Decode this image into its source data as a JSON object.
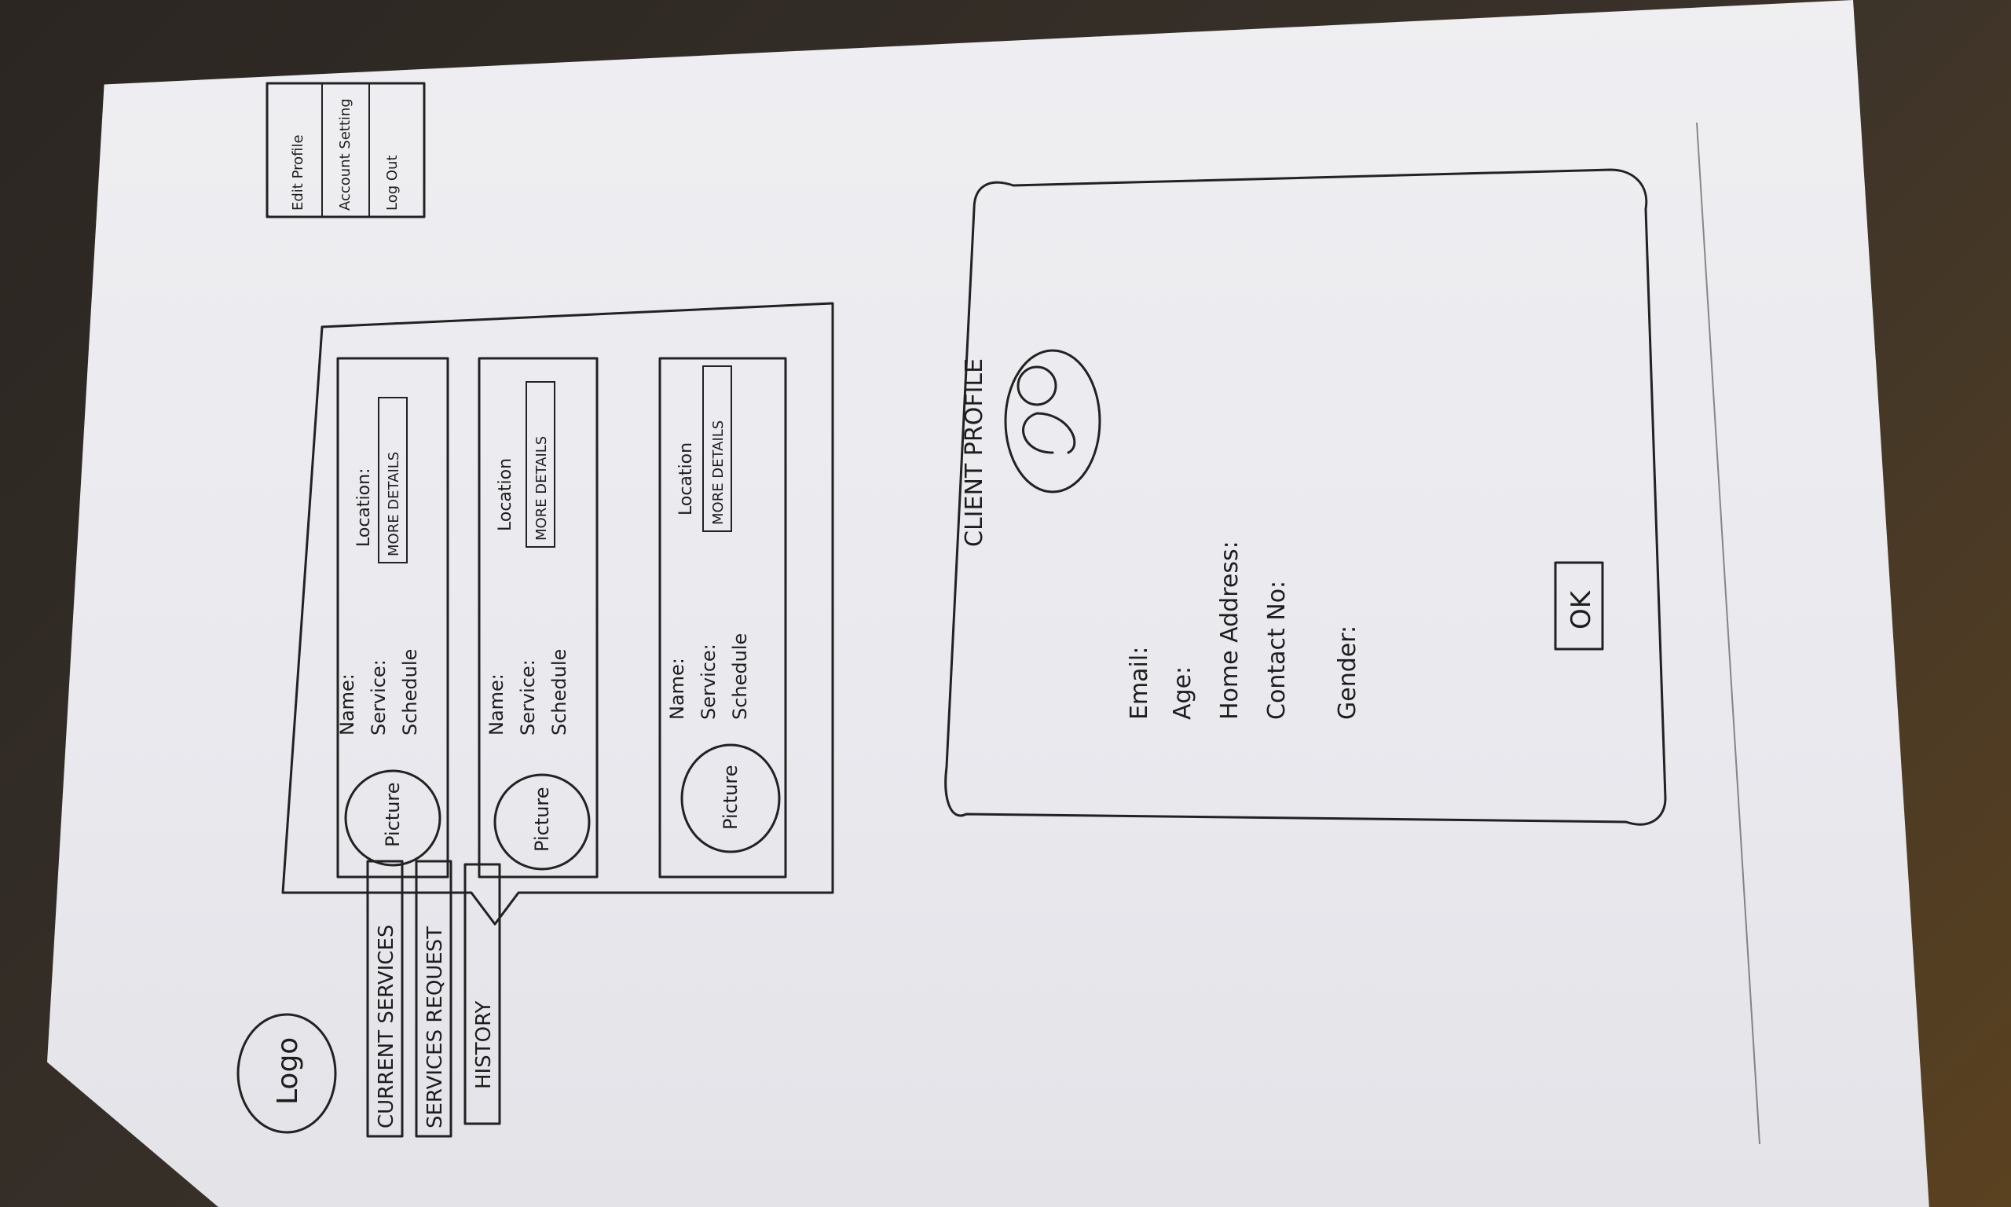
{
  "header": {
    "logo": "Logo",
    "account_menu": [
      "Edit Profile",
      "Account Setting",
      "Log Out"
    ]
  },
  "nav": {
    "tabs": [
      "CURRENT SERVICES",
      "SERVICES REQUEST",
      "HISTORY"
    ]
  },
  "requests": [
    {
      "picture": "Picture",
      "name": "Name:",
      "service": "Service:",
      "schedule": "Schedule",
      "location": "Location:",
      "button": "MORE DETAILS"
    },
    {
      "picture": "Picture",
      "name": "Name:",
      "service": "Service:",
      "schedule": "Schedule",
      "location": "Location",
      "button": "MORE DETAILS"
    },
    {
      "picture": "Picture",
      "name": "Name:",
      "service": "Service:",
      "schedule": "Schedule",
      "location": "Location",
      "button": "MORE DETAILS"
    }
  ],
  "client_profile": {
    "title": "CLIENT PROFILE",
    "fields": [
      "Email:",
      "Age:",
      "Home Address:",
      "Contact No:",
      "Gender:"
    ],
    "ok_button": "OK"
  },
  "colors": {
    "ink": "#222222",
    "paper": "#ececf0"
  }
}
